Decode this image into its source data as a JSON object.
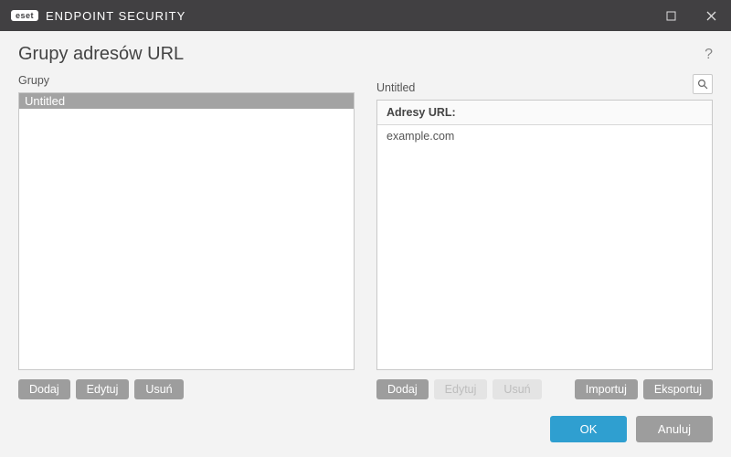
{
  "titlebar": {
    "brand_logo": "eset",
    "brand_text": "ENDPOINT SECURITY"
  },
  "header": {
    "title": "Grupy adresów URL",
    "help": "?"
  },
  "left": {
    "label": "Grupy",
    "items": [
      "Untitled"
    ],
    "selected_index": 0,
    "buttons": {
      "add": "Dodaj",
      "edit": "Edytuj",
      "delete": "Usuń"
    }
  },
  "right": {
    "label": "Untitled",
    "table_header": "Adresy URL:",
    "rows": [
      "example.com"
    ],
    "buttons": {
      "add": "Dodaj",
      "edit": "Edytuj",
      "delete": "Usuń",
      "import": "Importuj",
      "export": "Eksportuj"
    }
  },
  "footer": {
    "ok": "OK",
    "cancel": "Anuluj"
  }
}
